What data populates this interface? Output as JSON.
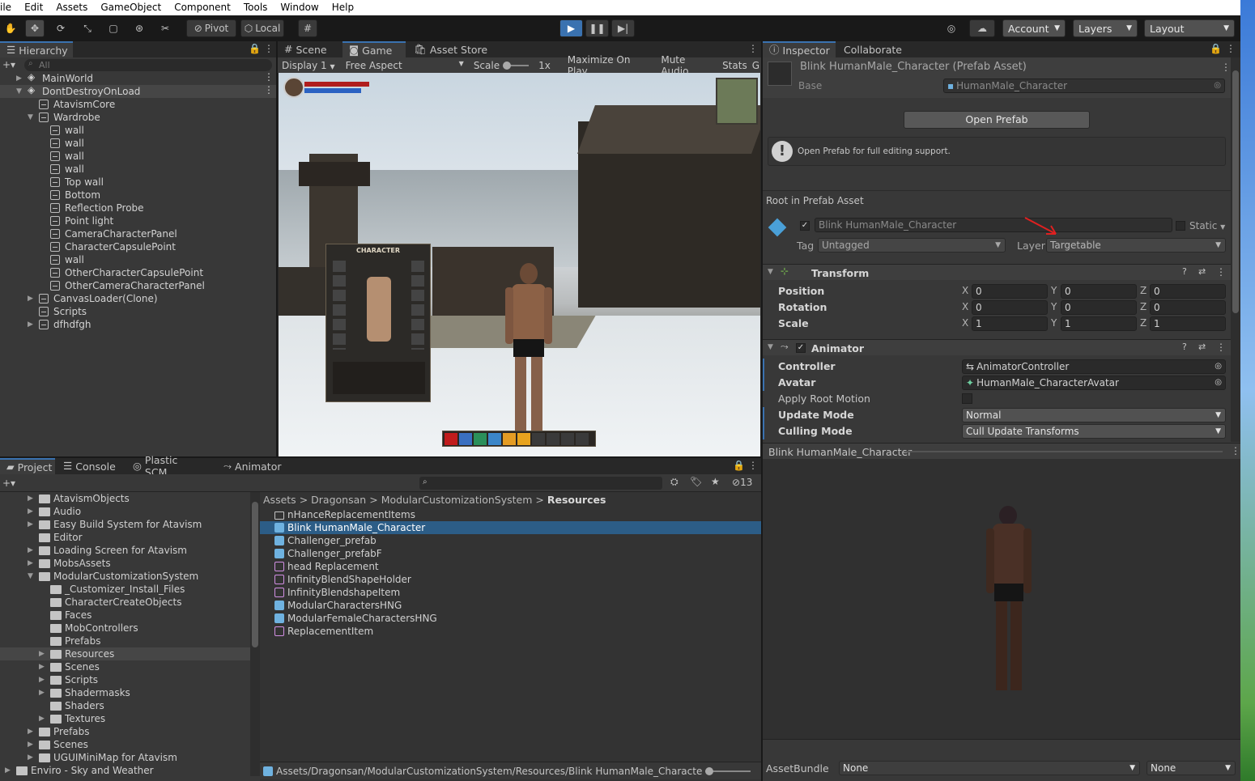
{
  "menu": [
    "ile",
    "Edit",
    "Assets",
    "GameObject",
    "Component",
    "Tools",
    "Window",
    "Help"
  ],
  "toolbar": {
    "pivot": "Pivot",
    "local": "Local",
    "account": "Account",
    "layers": "Layers",
    "layout": "Layout"
  },
  "hierarchy": {
    "tab": "Hierarchy",
    "search_placeholder": "All",
    "items": [
      {
        "label": "MainWorld",
        "depth": 0,
        "kind": "scene",
        "arrow": "right"
      },
      {
        "label": "DontDestroyOnLoad",
        "depth": 0,
        "kind": "scene",
        "arrow": "down",
        "selected": true
      },
      {
        "label": "AtavismCore",
        "depth": 1,
        "kind": "obj",
        "arrow": ""
      },
      {
        "label": "Wardrobe",
        "depth": 1,
        "kind": "obj",
        "arrow": "down"
      },
      {
        "label": "wall",
        "depth": 2,
        "kind": "obj",
        "arrow": ""
      },
      {
        "label": "wall",
        "depth": 2,
        "kind": "obj",
        "arrow": ""
      },
      {
        "label": "wall",
        "depth": 2,
        "kind": "obj",
        "arrow": ""
      },
      {
        "label": "wall",
        "depth": 2,
        "kind": "obj",
        "arrow": ""
      },
      {
        "label": "Top wall",
        "depth": 2,
        "kind": "obj",
        "arrow": ""
      },
      {
        "label": "Bottom",
        "depth": 2,
        "kind": "obj",
        "arrow": ""
      },
      {
        "label": "Reflection Probe",
        "depth": 2,
        "kind": "obj",
        "arrow": ""
      },
      {
        "label": "Point light",
        "depth": 2,
        "kind": "obj",
        "arrow": ""
      },
      {
        "label": "CameraCharacterPanel",
        "depth": 2,
        "kind": "obj",
        "arrow": ""
      },
      {
        "label": "CharacterCapsulePoint",
        "depth": 2,
        "kind": "obj",
        "arrow": ""
      },
      {
        "label": "wall",
        "depth": 2,
        "kind": "obj",
        "arrow": ""
      },
      {
        "label": "OtherCharacterCapsulePoint",
        "depth": 2,
        "kind": "obj",
        "arrow": ""
      },
      {
        "label": "OtherCameraCharacterPanel",
        "depth": 2,
        "kind": "obj",
        "arrow": ""
      },
      {
        "label": "CanvasLoader(Clone)",
        "depth": 1,
        "kind": "obj",
        "arrow": "right"
      },
      {
        "label": "Scripts",
        "depth": 1,
        "kind": "obj",
        "arrow": ""
      },
      {
        "label": "dfhdfgh",
        "depth": 1,
        "kind": "obj",
        "arrow": "right"
      }
    ]
  },
  "game": {
    "tabs": [
      "Scene",
      "Game",
      "Asset Store"
    ],
    "display": "Display 1",
    "aspect": "Free Aspect",
    "scale_label": "Scale",
    "scale_value": "1x",
    "maximize": "Maximize On Play",
    "mute": "Mute Audio",
    "stats": "Stats",
    "gizmos": "G",
    "char_panel_title": "CHARACTER"
  },
  "inspector": {
    "tabs": [
      "Inspector",
      "Collaborate"
    ],
    "title": "Blink HumanMale_Character (Prefab Asset)",
    "base_label": "Base",
    "base_value": "HumanMale_Character",
    "open_prefab": "Open Prefab",
    "info": "Open Prefab for full editing support.",
    "root_label": "Root in Prefab Asset",
    "object_name": "Blink HumanMale_Character",
    "static_label": "Static",
    "tag_label": "Tag",
    "tag_value": "Untagged",
    "layer_label": "Layer",
    "layer_value": "Targetable",
    "transform": {
      "title": "Transform",
      "rows": [
        {
          "label": "Position",
          "x": "0",
          "y": "0",
          "z": "0"
        },
        {
          "label": "Rotation",
          "x": "0",
          "y": "0",
          "z": "0"
        },
        {
          "label": "Scale",
          "x": "1",
          "y": "1",
          "z": "1"
        }
      ]
    },
    "animator": {
      "title": "Animator",
      "controller_label": "Controller",
      "controller_value": "AnimatorController",
      "avatar_label": "Avatar",
      "avatar_value": "HumanMale_CharacterAvatar",
      "root_motion_label": "Apply Root Motion",
      "update_label": "Update Mode",
      "update_value": "Normal",
      "culling_label": "Culling Mode",
      "culling_value": "Cull Update Transforms"
    },
    "preview_title": "Blink HumanMale_Character",
    "assetbundle_label": "AssetBundle",
    "assetbundle_value": "None",
    "assetbundle_variant": "None"
  },
  "project": {
    "tabs": [
      "Project",
      "Console",
      "Plastic SCM",
      "Animator"
    ],
    "hidden_count": "13",
    "tree": [
      {
        "label": "AtavismObjects",
        "depth": 1,
        "arrow": "right"
      },
      {
        "label": "Audio",
        "depth": 1,
        "arrow": "right"
      },
      {
        "label": "Easy Build System for Atavism",
        "depth": 1,
        "arrow": "right"
      },
      {
        "label": "Editor",
        "depth": 1,
        "arrow": ""
      },
      {
        "label": "Loading Screen for Atavism",
        "depth": 1,
        "arrow": "right"
      },
      {
        "label": "MobsAssets",
        "depth": 1,
        "arrow": "right"
      },
      {
        "label": "ModularCustomizationSystem",
        "depth": 1,
        "arrow": "down"
      },
      {
        "label": "_Customizer_Install_Files",
        "depth": 2,
        "arrow": ""
      },
      {
        "label": "CharacterCreateObjects",
        "depth": 2,
        "arrow": ""
      },
      {
        "label": "Faces",
        "depth": 2,
        "arrow": ""
      },
      {
        "label": "MobControllers",
        "depth": 2,
        "arrow": ""
      },
      {
        "label": "Prefabs",
        "depth": 2,
        "arrow": ""
      },
      {
        "label": "Resources",
        "depth": 2,
        "arrow": "right",
        "selected": true
      },
      {
        "label": "Scenes",
        "depth": 2,
        "arrow": "right"
      },
      {
        "label": "Scripts",
        "depth": 2,
        "arrow": "right"
      },
      {
        "label": "Shadermasks",
        "depth": 2,
        "arrow": "right"
      },
      {
        "label": "Shaders",
        "depth": 2,
        "arrow": ""
      },
      {
        "label": "Textures",
        "depth": 2,
        "arrow": "right"
      },
      {
        "label": "Prefabs",
        "depth": 1,
        "arrow": "right"
      },
      {
        "label": "Scenes",
        "depth": 1,
        "arrow": "right"
      },
      {
        "label": "UGUIMiniMap for Atavism",
        "depth": 1,
        "arrow": "right"
      },
      {
        "label": "Enviro - Sky and Weather",
        "depth": 0,
        "arrow": "right"
      }
    ],
    "breadcrumb": [
      "Assets",
      "Dragonsan",
      "ModularCustomizationSystem",
      "Resources"
    ],
    "files": [
      {
        "label": "nHanceReplacementItems",
        "kind": "folder"
      },
      {
        "label": "Blink HumanMale_Character",
        "kind": "prefab",
        "selected": true
      },
      {
        "label": "Challenger_prefab",
        "kind": "prefab"
      },
      {
        "label": "Challenger_prefabF",
        "kind": "prefab"
      },
      {
        "label": "head Replacement",
        "kind": "script"
      },
      {
        "label": "InfinityBlendShapeHolder",
        "kind": "script"
      },
      {
        "label": "InfinityBlendshapeItem",
        "kind": "script"
      },
      {
        "label": "ModularCharactersHNG",
        "kind": "prefab"
      },
      {
        "label": "ModularFemaleCharactersHNG",
        "kind": "prefab"
      },
      {
        "label": "ReplacementItem",
        "kind": "script"
      }
    ],
    "path": "Assets/Dragonsan/ModularCustomizationSystem/Resources/Blink HumanMale_Character.pre"
  }
}
